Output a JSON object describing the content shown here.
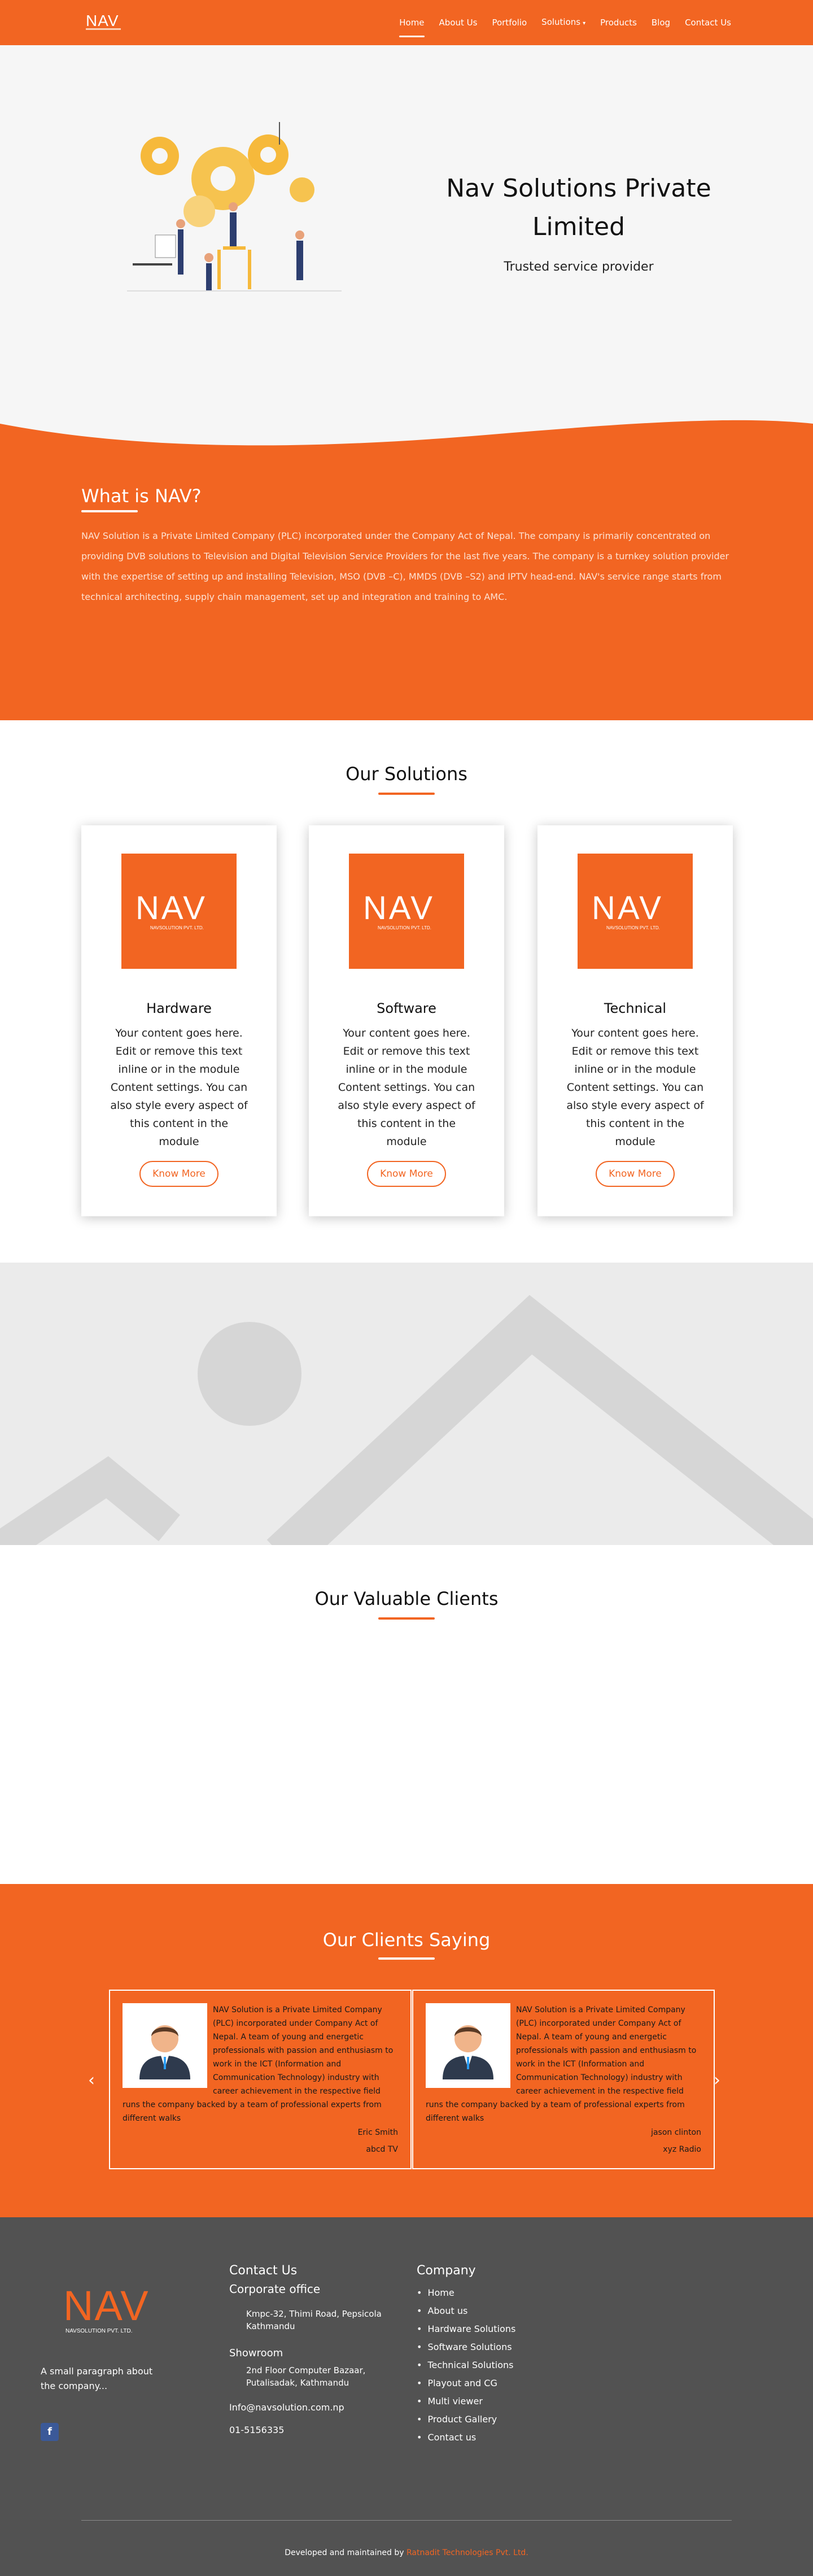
{
  "brand": {
    "accent": "#f26522",
    "footer_bg": "#525252",
    "hero_bg": "#f6f6f6"
  },
  "nav": {
    "items": [
      {
        "label": "Home"
      },
      {
        "label": "About Us"
      },
      {
        "label": "Portfolio"
      },
      {
        "label": "Solutions"
      },
      {
        "label": "Products"
      },
      {
        "label": "Blog"
      },
      {
        "label": "Contact Us"
      }
    ]
  },
  "hero": {
    "title": "Nav Solutions Private Limited",
    "subtitle": "Trusted service provider"
  },
  "about": {
    "title": "What is NAV?",
    "text": "NAV Solution is a Private Limited Company (PLC) incorporated under the Company Act of Nepal. The company is primarily concentrated on providing DVB solutions to Television and Digital Television Service Providers for the last five years. The company is a turnkey solution provider with the expertise of setting up and installing Television, MSO (DVB –C), MMDS (DVB –S2) and IPTV head-end. NAV's service range starts from technical architecting, supply chain management, set up and integration and training to AMC."
  },
  "solutions": {
    "title": "Our Solutions",
    "cards": [
      {
        "title": "Hardware",
        "text": "Your content goes here. Edit or remove this text inline or in the module Content settings. You can also style every aspect of this content in the module",
        "button": "Know More"
      },
      {
        "title": "Software",
        "text": "Your content goes here. Edit or remove this text inline or in the module Content settings. You can also style every aspect of this content in the module",
        "button": "Know More"
      },
      {
        "title": "Technical",
        "text": "Your content goes here. Edit or remove this text inline or in the module Content settings. You can also style every aspect of this content in the module",
        "button": "Know More"
      }
    ]
  },
  "clients": {
    "title": "Our Valuable Clients"
  },
  "testimonials": {
    "title": "Our Clients Saying",
    "items": [
      {
        "text": "NAV Solution is a Private Limited Company (PLC) incorporated under Company Act of Nepal. A team of young and energetic professionals with passion and enthusiasm to work in the ICT (Information and Communication Technology) industry with career achievement in the respective field runs the company backed by a team of professional experts from different walks",
        "name": "Eric Smith",
        "company": "abcd TV"
      },
      {
        "text": "NAV Solution is a Private Limited Company (PLC) incorporated under Company Act of Nepal. A team of young and energetic professionals with passion and enthusiasm to work in the ICT (Information and Communication Technology) industry with career achievement in the respective field runs the company backed by a team of professional experts from different walks",
        "name": "jason clinton",
        "company": "xyz Radio"
      }
    ]
  },
  "footer": {
    "tagline": "A small paragraph about the company...",
    "facebook": "f",
    "contact": {
      "title": "Contact Us",
      "office_label": "Corporate office",
      "office_address": "Kmpc-32, Thimi Road, Pepsicola Kathmandu",
      "showroom_label": "Showroom",
      "showroom_address": "2nd Floor Computer Bazaar, Putalisadak, Kathmandu",
      "email": "Info@navsolution.com.np",
      "phone": "01-5156335"
    },
    "company": {
      "title": "Company",
      "links": [
        "Home",
        "About us",
        "Hardware Solutions",
        "Software Solutions",
        "Technical Solutions",
        "Playout and CG",
        "Multi viewer",
        "Product Gallery",
        "Contact us"
      ]
    },
    "credit_prefix": "Developed and maintained by",
    "credit_link": "Ratnadit Technologies Pvt. Ltd."
  }
}
